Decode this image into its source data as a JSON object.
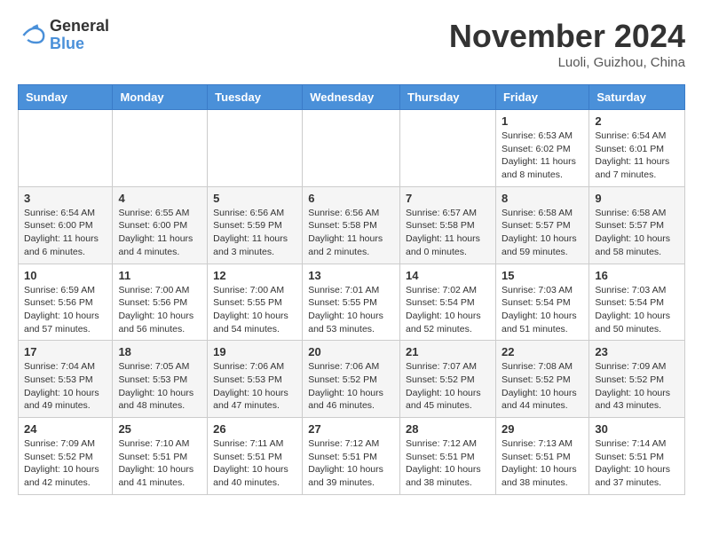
{
  "header": {
    "logo_line1": "General",
    "logo_line2": "Blue",
    "month_title": "November 2024",
    "location": "Luoli, Guizhou, China"
  },
  "weekdays": [
    "Sunday",
    "Monday",
    "Tuesday",
    "Wednesday",
    "Thursday",
    "Friday",
    "Saturday"
  ],
  "weeks": [
    [
      {
        "day": "",
        "info": ""
      },
      {
        "day": "",
        "info": ""
      },
      {
        "day": "",
        "info": ""
      },
      {
        "day": "",
        "info": ""
      },
      {
        "day": "",
        "info": ""
      },
      {
        "day": "1",
        "info": "Sunrise: 6:53 AM\nSunset: 6:02 PM\nDaylight: 11 hours\nand 8 minutes."
      },
      {
        "day": "2",
        "info": "Sunrise: 6:54 AM\nSunset: 6:01 PM\nDaylight: 11 hours\nand 7 minutes."
      }
    ],
    [
      {
        "day": "3",
        "info": "Sunrise: 6:54 AM\nSunset: 6:00 PM\nDaylight: 11 hours\nand 6 minutes."
      },
      {
        "day": "4",
        "info": "Sunrise: 6:55 AM\nSunset: 6:00 PM\nDaylight: 11 hours\nand 4 minutes."
      },
      {
        "day": "5",
        "info": "Sunrise: 6:56 AM\nSunset: 5:59 PM\nDaylight: 11 hours\nand 3 minutes."
      },
      {
        "day": "6",
        "info": "Sunrise: 6:56 AM\nSunset: 5:58 PM\nDaylight: 11 hours\nand 2 minutes."
      },
      {
        "day": "7",
        "info": "Sunrise: 6:57 AM\nSunset: 5:58 PM\nDaylight: 11 hours\nand 0 minutes."
      },
      {
        "day": "8",
        "info": "Sunrise: 6:58 AM\nSunset: 5:57 PM\nDaylight: 10 hours\nand 59 minutes."
      },
      {
        "day": "9",
        "info": "Sunrise: 6:58 AM\nSunset: 5:57 PM\nDaylight: 10 hours\nand 58 minutes."
      }
    ],
    [
      {
        "day": "10",
        "info": "Sunrise: 6:59 AM\nSunset: 5:56 PM\nDaylight: 10 hours\nand 57 minutes."
      },
      {
        "day": "11",
        "info": "Sunrise: 7:00 AM\nSunset: 5:56 PM\nDaylight: 10 hours\nand 56 minutes."
      },
      {
        "day": "12",
        "info": "Sunrise: 7:00 AM\nSunset: 5:55 PM\nDaylight: 10 hours\nand 54 minutes."
      },
      {
        "day": "13",
        "info": "Sunrise: 7:01 AM\nSunset: 5:55 PM\nDaylight: 10 hours\nand 53 minutes."
      },
      {
        "day": "14",
        "info": "Sunrise: 7:02 AM\nSunset: 5:54 PM\nDaylight: 10 hours\nand 52 minutes."
      },
      {
        "day": "15",
        "info": "Sunrise: 7:03 AM\nSunset: 5:54 PM\nDaylight: 10 hours\nand 51 minutes."
      },
      {
        "day": "16",
        "info": "Sunrise: 7:03 AM\nSunset: 5:54 PM\nDaylight: 10 hours\nand 50 minutes."
      }
    ],
    [
      {
        "day": "17",
        "info": "Sunrise: 7:04 AM\nSunset: 5:53 PM\nDaylight: 10 hours\nand 49 minutes."
      },
      {
        "day": "18",
        "info": "Sunrise: 7:05 AM\nSunset: 5:53 PM\nDaylight: 10 hours\nand 48 minutes."
      },
      {
        "day": "19",
        "info": "Sunrise: 7:06 AM\nSunset: 5:53 PM\nDaylight: 10 hours\nand 47 minutes."
      },
      {
        "day": "20",
        "info": "Sunrise: 7:06 AM\nSunset: 5:52 PM\nDaylight: 10 hours\nand 46 minutes."
      },
      {
        "day": "21",
        "info": "Sunrise: 7:07 AM\nSunset: 5:52 PM\nDaylight: 10 hours\nand 45 minutes."
      },
      {
        "day": "22",
        "info": "Sunrise: 7:08 AM\nSunset: 5:52 PM\nDaylight: 10 hours\nand 44 minutes."
      },
      {
        "day": "23",
        "info": "Sunrise: 7:09 AM\nSunset: 5:52 PM\nDaylight: 10 hours\nand 43 minutes."
      }
    ],
    [
      {
        "day": "24",
        "info": "Sunrise: 7:09 AM\nSunset: 5:52 PM\nDaylight: 10 hours\nand 42 minutes."
      },
      {
        "day": "25",
        "info": "Sunrise: 7:10 AM\nSunset: 5:51 PM\nDaylight: 10 hours\nand 41 minutes."
      },
      {
        "day": "26",
        "info": "Sunrise: 7:11 AM\nSunset: 5:51 PM\nDaylight: 10 hours\nand 40 minutes."
      },
      {
        "day": "27",
        "info": "Sunrise: 7:12 AM\nSunset: 5:51 PM\nDaylight: 10 hours\nand 39 minutes."
      },
      {
        "day": "28",
        "info": "Sunrise: 7:12 AM\nSunset: 5:51 PM\nDaylight: 10 hours\nand 38 minutes."
      },
      {
        "day": "29",
        "info": "Sunrise: 7:13 AM\nSunset: 5:51 PM\nDaylight: 10 hours\nand 38 minutes."
      },
      {
        "day": "30",
        "info": "Sunrise: 7:14 AM\nSunset: 5:51 PM\nDaylight: 10 hours\nand 37 minutes."
      }
    ]
  ]
}
